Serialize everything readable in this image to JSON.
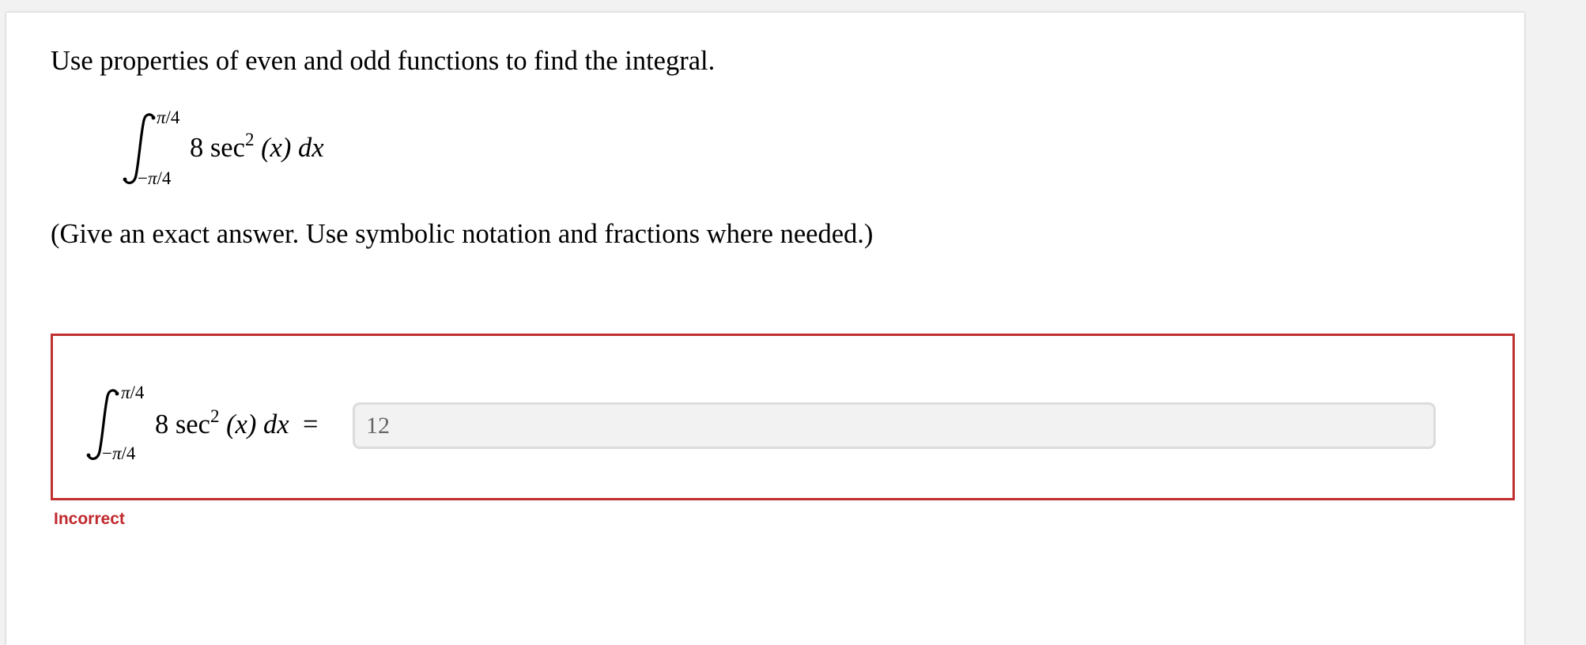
{
  "question": {
    "prompt": "Use properties of even and odd functions to find the integral.",
    "instructions": "(Give an exact answer. Use symbolic notation and fractions where needed.)",
    "integral": {
      "upper_limit": "π/4",
      "lower_limit": "−π/4",
      "coefficient": "8",
      "function": "sec",
      "exponent": "2",
      "argument": "(x)",
      "differential": "dx"
    }
  },
  "answer": {
    "equals_sign": "=",
    "value": "12",
    "status": "Incorrect",
    "status_color": "#c0282d",
    "border_color": "#c0302f"
  }
}
